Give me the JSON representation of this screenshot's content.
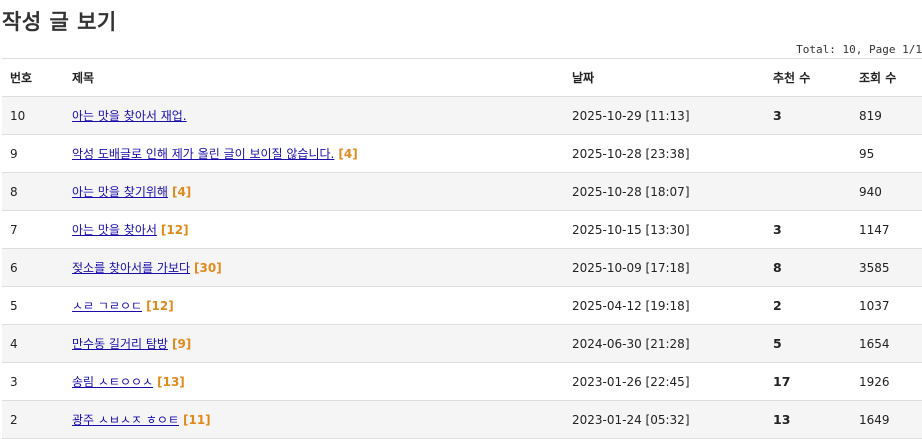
{
  "page": {
    "title": "작성 글 보기"
  },
  "summary": {
    "text": "Total: 10, Page 1/1"
  },
  "table": {
    "headers": {
      "no": "번호",
      "title": "제목",
      "date": "날짜",
      "rec": "추천 수",
      "views": "조회 수"
    },
    "rows": [
      {
        "no": "10",
        "title": "아는 맛을 찾아서 재업.",
        "comments": "",
        "date": "2025-10-29 [11:13]",
        "rec": "3",
        "views": "819"
      },
      {
        "no": "9",
        "title": "악성 도배글로 인해 제가 올린 글이 보이질 않습니다.",
        "comments": "[4]",
        "date": "2025-10-28 [23:38]",
        "rec": "",
        "views": "95"
      },
      {
        "no": "8",
        "title": "아는 맛을 찾기위해",
        "comments": "[4]",
        "date": "2025-10-28 [18:07]",
        "rec": "",
        "views": "940"
      },
      {
        "no": "7",
        "title": "아는 맛을 찾아서",
        "comments": "[12]",
        "date": "2025-10-15 [13:30]",
        "rec": "3",
        "views": "1147"
      },
      {
        "no": "6",
        "title": "젖소를 찾아서를 가보다",
        "comments": "[30]",
        "date": "2025-10-09 [17:18]",
        "rec": "8",
        "views": "3585"
      },
      {
        "no": "5",
        "title": "ㅅㄹ ㄱㄹㅇㄷ",
        "comments": "[12]",
        "date": "2025-04-12 [19:18]",
        "rec": "2",
        "views": "1037"
      },
      {
        "no": "4",
        "title": "만수동 길거리 탐방",
        "comments": "[9]",
        "date": "2024-06-30 [21:28]",
        "rec": "5",
        "views": "1654"
      },
      {
        "no": "3",
        "title": "송림 ㅅㅌㅇㅇㅅ",
        "comments": "[13]",
        "date": "2023-01-26 [22:45]",
        "rec": "17",
        "views": "1926"
      },
      {
        "no": "2",
        "title": "광주 ㅅㅂㅅㅈ ㅎㅇㅌ",
        "comments": "[11]",
        "date": "2023-01-24 [05:32]",
        "rec": "13",
        "views": "1649"
      }
    ]
  },
  "colors": {
    "link": "#1a0dab",
    "comment_count": "#e08a1e",
    "row_alt": "#f5f5f5",
    "border": "#dddddd"
  }
}
